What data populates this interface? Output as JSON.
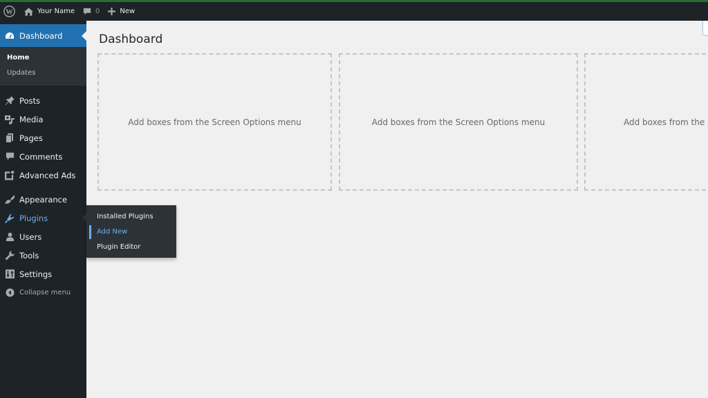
{
  "admin_bar": {
    "wp_logo_icon": "wordpress-logo-icon",
    "site_name": "Your Name",
    "comments_count": "0",
    "new_label": "New"
  },
  "sidebar": {
    "dashboard": {
      "label": "Dashboard",
      "icon": "dashboard-gauge-icon",
      "submenu": [
        {
          "label": "Home",
          "active": true
        },
        {
          "label": "Updates",
          "active": false
        }
      ]
    },
    "items": [
      {
        "label": "Posts",
        "icon": "pushpin-icon"
      },
      {
        "label": "Media",
        "icon": "media-icon"
      },
      {
        "label": "Pages",
        "icon": "pages-icon"
      },
      {
        "label": "Comments",
        "icon": "comment-icon"
      },
      {
        "label": "Advanced Ads",
        "icon": "advanced-ads-icon"
      },
      {
        "label": "Appearance",
        "icon": "paintbrush-icon"
      },
      {
        "label": "Plugins",
        "icon": "plugin-icon"
      },
      {
        "label": "Users",
        "icon": "user-icon"
      },
      {
        "label": "Tools",
        "icon": "wrench-icon"
      },
      {
        "label": "Settings",
        "icon": "settings-sliders-icon"
      }
    ],
    "collapse_label": "Collapse menu"
  },
  "plugins_flyout": [
    {
      "label": "Installed Plugins",
      "focused": false
    },
    {
      "label": "Add New",
      "focused": true
    },
    {
      "label": "Plugin Editor",
      "focused": false
    }
  ],
  "main": {
    "page_title": "Dashboard",
    "empty_box_text": "Add boxes from the Screen Options menu",
    "box_count": 3
  },
  "colors": {
    "admin_bar_bg": "#1d2327",
    "sidebar_bg": "#1d2327",
    "submenu_bg": "#2c3338",
    "accent": "#2271b1",
    "highlight_text": "#72aee6",
    "page_bg": "#f0f0f1"
  }
}
